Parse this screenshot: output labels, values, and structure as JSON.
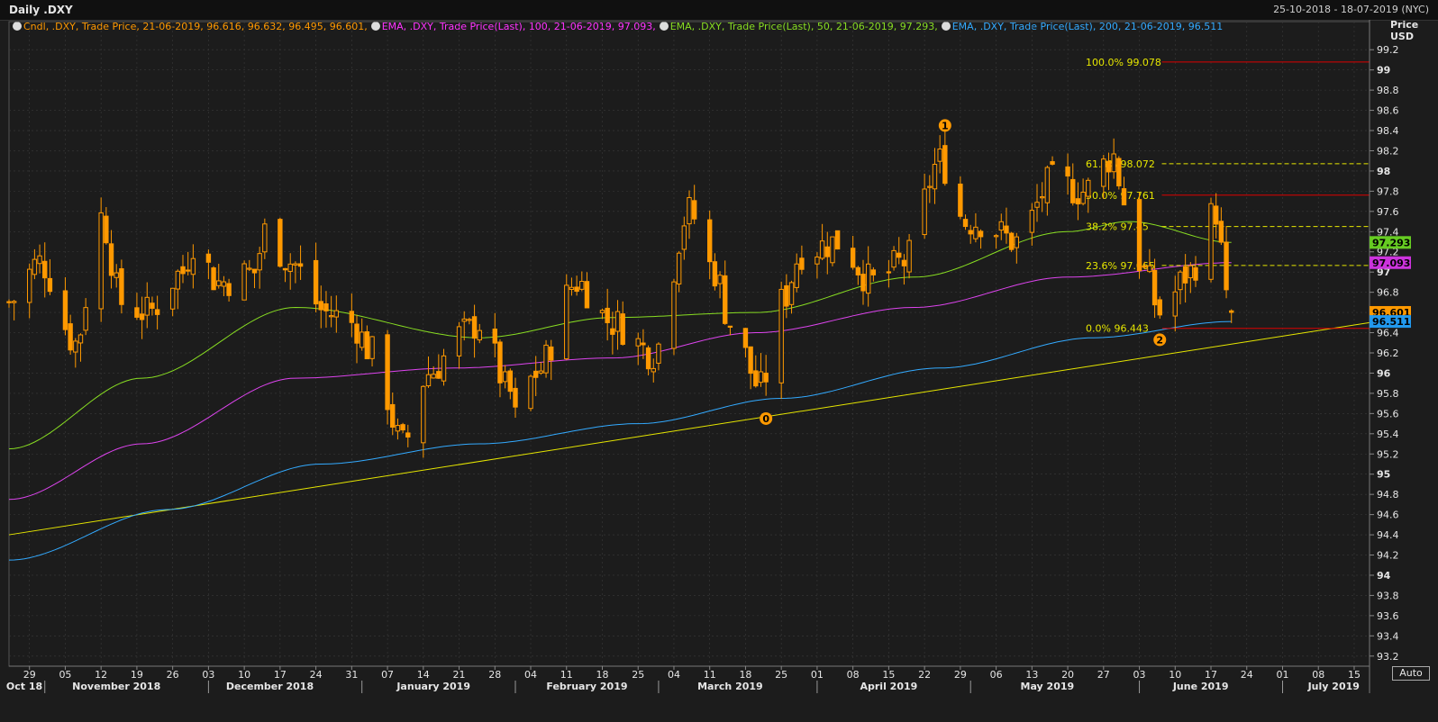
{
  "window": {
    "title": "Daily .DXY",
    "date_range": "25-10-2018 - 18-07-2019 (NYC)",
    "price_label": "Price",
    "currency_label": "USD",
    "auto_label": "Auto"
  },
  "legend": [
    {
      "text": "Cndl, .DXY, Trade Price, 21-06-2019, 96.616, 96.632, 96.495, 96.601,",
      "color": "#ff9900"
    },
    {
      "text": "EMA, .DXY, Trade Price(Last), 100, 21-06-2019, 97.093,",
      "color": "#ff33ff"
    },
    {
      "text": "EMA, .DXY, Trade Price(Last), 50, 21-06-2019, 97.293,",
      "color": "#88dd22"
    },
    {
      "text": "EMA, .DXY, Trade Price(Last), 200, 21-06-2019, 96.511",
      "color": "#33aaff"
    }
  ],
  "colors": {
    "background": "#1c1c1c",
    "grid": "#3a3a3a",
    "candle": "#ff9900",
    "ema50": "#88dd22",
    "ema100": "#dd44ee",
    "ema200": "#33aaff",
    "trendline": "#e6e600",
    "fib_solid": "#dd0000",
    "fib_dashed": "#e6e600",
    "axis_text": "#e6e6e6"
  },
  "chart_data": {
    "type": "candlestick",
    "x_range": [
      "2018-10-25",
      "2019-07-18"
    ],
    "ylim": [
      93.1,
      99.3
    ],
    "y_ticks": [
      93.2,
      93.4,
      93.6,
      93.8,
      94,
      94.2,
      94.4,
      94.6,
      94.8,
      95,
      95.2,
      95.4,
      95.6,
      95.8,
      96,
      96.2,
      96.4,
      96.6,
      96.8,
      97,
      97.2,
      97.4,
      97.6,
      97.8,
      98,
      98.2,
      98.4,
      98.6,
      98.8,
      99,
      99.2
    ],
    "y_tick_labels": [
      "93.2",
      "93.4",
      "93.6",
      "93.8",
      "94",
      "94.2",
      "94.4",
      "94.6",
      "94.8",
      "95",
      "95.2",
      "95.4",
      "95.6",
      "95.8",
      "96",
      "96.2",
      "96.4",
      "96.6",
      "96.8",
      "97",
      "97.2",
      "97.4",
      "97.6",
      "97.8",
      "98",
      "98.2",
      "98.4",
      "98.6",
      "98.8",
      "99",
      "99.2"
    ],
    "bold_ticks": [
      "94",
      "95",
      "96",
      "97",
      "98",
      "99"
    ],
    "day_ticks": [
      {
        "date": "2018-10-29",
        "label": "29"
      },
      {
        "date": "2018-11-05",
        "label": "05"
      },
      {
        "date": "2018-11-12",
        "label": "12"
      },
      {
        "date": "2018-11-19",
        "label": "19"
      },
      {
        "date": "2018-11-26",
        "label": "26"
      },
      {
        "date": "2018-12-03",
        "label": "03"
      },
      {
        "date": "2018-12-10",
        "label": "10"
      },
      {
        "date": "2018-12-17",
        "label": "17"
      },
      {
        "date": "2018-12-24",
        "label": "24"
      },
      {
        "date": "2018-12-31",
        "label": "31"
      },
      {
        "date": "2019-01-07",
        "label": "07"
      },
      {
        "date": "2019-01-14",
        "label": "14"
      },
      {
        "date": "2019-01-21",
        "label": "21"
      },
      {
        "date": "2019-01-28",
        "label": "28"
      },
      {
        "date": "2019-02-04",
        "label": "04"
      },
      {
        "date": "2019-02-11",
        "label": "11"
      },
      {
        "date": "2019-02-18",
        "label": "18"
      },
      {
        "date": "2019-02-25",
        "label": "25"
      },
      {
        "date": "2019-03-04",
        "label": "04"
      },
      {
        "date": "2019-03-11",
        "label": "11"
      },
      {
        "date": "2019-03-18",
        "label": "18"
      },
      {
        "date": "2019-03-25",
        "label": "25"
      },
      {
        "date": "2019-04-01",
        "label": "01"
      },
      {
        "date": "2019-04-08",
        "label": "08"
      },
      {
        "date": "2019-04-15",
        "label": "15"
      },
      {
        "date": "2019-04-22",
        "label": "22"
      },
      {
        "date": "2019-04-29",
        "label": "29"
      },
      {
        "date": "2019-05-06",
        "label": "06"
      },
      {
        "date": "2019-05-13",
        "label": "13"
      },
      {
        "date": "2019-05-20",
        "label": "20"
      },
      {
        "date": "2019-05-27",
        "label": "27"
      },
      {
        "date": "2019-06-03",
        "label": "03"
      },
      {
        "date": "2019-06-10",
        "label": "10"
      },
      {
        "date": "2019-06-17",
        "label": "17"
      },
      {
        "date": "2019-06-24",
        "label": "24"
      },
      {
        "date": "2019-07-01",
        "label": "01"
      },
      {
        "date": "2019-07-08",
        "label": "08"
      },
      {
        "date": "2019-07-15",
        "label": "15"
      }
    ],
    "month_labels": [
      {
        "date": "2018-10-28",
        "label": "Oct 18"
      },
      {
        "date": "2018-11-15",
        "label": "November 2018"
      },
      {
        "date": "2018-12-15",
        "label": "December 2018"
      },
      {
        "date": "2019-01-16",
        "label": "January 2019"
      },
      {
        "date": "2019-02-15",
        "label": "February 2019"
      },
      {
        "date": "2019-03-15",
        "label": "March 2019"
      },
      {
        "date": "2019-04-15",
        "label": "April 2019"
      },
      {
        "date": "2019-05-16",
        "label": "May 2019"
      },
      {
        "date": "2019-06-15",
        "label": "June 2019"
      },
      {
        "date": "2019-07-11",
        "label": "July 2019"
      }
    ],
    "month_separators": [
      "2018-11-01",
      "2018-12-03",
      "2019-01-02",
      "2019-02-01",
      "2019-03-01",
      "2019-04-01",
      "2019-05-01",
      "2019-06-03",
      "2019-07-01"
    ],
    "ohlc_anchors": [
      [
        "2018-10-25",
        96.7
      ],
      [
        "2018-10-31",
        97.1
      ],
      [
        "2018-11-07",
        96.3
      ],
      [
        "2018-11-12",
        97.55
      ],
      [
        "2018-11-16",
        96.7
      ],
      [
        "2018-11-21",
        96.6
      ],
      [
        "2018-11-28",
        97.0
      ],
      [
        "2018-11-30",
        97.3
      ],
      [
        "2018-12-05",
        96.9
      ],
      [
        "2018-12-12",
        97.0
      ],
      [
        "2018-12-14",
        97.4
      ],
      [
        "2018-12-19",
        97.1
      ],
      [
        "2018-12-26",
        96.6
      ],
      [
        "2018-12-31",
        96.5
      ],
      [
        "2019-01-04",
        96.2
      ],
      [
        "2019-01-10",
        95.3
      ],
      [
        "2019-01-15",
        96.0
      ],
      [
        "2019-01-22",
        96.4
      ],
      [
        "2019-01-25",
        96.5
      ],
      [
        "2019-01-31",
        95.8
      ],
      [
        "2019-02-01",
        95.55
      ],
      [
        "2019-02-05",
        96.0
      ],
      [
        "2019-02-13",
        96.9
      ],
      [
        "2019-02-20",
        96.5
      ],
      [
        "2019-02-28",
        96.2
      ],
      [
        "2019-03-07",
        97.6
      ],
      [
        "2019-03-12",
        97.0
      ],
      [
        "2019-03-15",
        96.5
      ],
      [
        "2019-03-21",
        95.85
      ],
      [
        "2019-03-25",
        96.7
      ],
      [
        "2019-03-29",
        97.2
      ],
      [
        "2019-04-05",
        97.3
      ],
      [
        "2019-04-12",
        96.9
      ],
      [
        "2019-04-18",
        97.1
      ],
      [
        "2019-04-25",
        98.1
      ],
      [
        "2019-04-30",
        97.5
      ],
      [
        "2019-05-03",
        97.5
      ],
      [
        "2019-05-10",
        97.3
      ],
      [
        "2019-05-17",
        97.9
      ],
      [
        "2019-05-23",
        97.8
      ],
      [
        "2019-05-29",
        98.15
      ],
      [
        "2019-05-31",
        97.7
      ],
      [
        "2019-06-04",
        97.0
      ],
      [
        "2019-06-07",
        96.6
      ],
      [
        "2019-06-13",
        97.0
      ],
      [
        "2019-06-17",
        97.55
      ],
      [
        "2019-06-18",
        97.6
      ],
      [
        "2019-06-19",
        97.2
      ],
      [
        "2019-06-20",
        96.7
      ],
      [
        "2019-06-21",
        96.601
      ]
    ],
    "last_candle": {
      "date": "2019-06-21",
      "open": 96.616,
      "high": 96.632,
      "low": 96.495,
      "close": 96.601
    },
    "series": [
      {
        "name": "EMA 50",
        "color": "#88dd22",
        "last": 97.293,
        "points": [
          [
            "2018-10-25",
            95.25
          ],
          [
            "2018-11-20",
            95.95
          ],
          [
            "2018-12-20",
            96.65
          ],
          [
            "2019-01-25",
            96.35
          ],
          [
            "2019-02-20",
            96.55
          ],
          [
            "2019-03-20",
            96.6
          ],
          [
            "2019-04-20",
            96.95
          ],
          [
            "2019-05-20",
            97.4
          ],
          [
            "2019-06-01",
            97.5
          ],
          [
            "2019-06-21",
            97.293
          ]
        ]
      },
      {
        "name": "EMA 100",
        "color": "#dd44ee",
        "last": 97.093,
        "points": [
          [
            "2018-10-25",
            94.75
          ],
          [
            "2018-11-20",
            95.3
          ],
          [
            "2018-12-20",
            95.95
          ],
          [
            "2019-01-20",
            96.05
          ],
          [
            "2019-02-20",
            96.15
          ],
          [
            "2019-03-20",
            96.4
          ],
          [
            "2019-04-20",
            96.65
          ],
          [
            "2019-05-20",
            96.95
          ],
          [
            "2019-06-21",
            97.093
          ]
        ]
      },
      {
        "name": "EMA 200",
        "color": "#33aaff",
        "last": 96.511,
        "points": [
          [
            "2018-10-25",
            94.15
          ],
          [
            "2018-11-25",
            94.65
          ],
          [
            "2018-12-25",
            95.1
          ],
          [
            "2019-01-25",
            95.3
          ],
          [
            "2019-02-25",
            95.5
          ],
          [
            "2019-03-25",
            95.75
          ],
          [
            "2019-04-25",
            96.05
          ],
          [
            "2019-05-25",
            96.35
          ],
          [
            "2019-06-21",
            96.511
          ]
        ]
      }
    ],
    "trendline": {
      "color": "#e6e600",
      "from": [
        "2018-10-25",
        94.4
      ],
      "to": [
        "2019-07-18",
        96.5
      ]
    },
    "fibonacci": [
      {
        "label": "100.0%",
        "value": 99.078,
        "text": "99.078",
        "style": "solid"
      },
      {
        "label": "61.8%",
        "value": 98.072,
        "text": "98.072",
        "style": "dashed"
      },
      {
        "label": "50.0%",
        "value": 97.761,
        "text": "97.761",
        "style": "solid"
      },
      {
        "label": "38.2%",
        "value": 97.45,
        "text": "97.45",
        "style": "dashed"
      },
      {
        "label": "23.6%",
        "value": 97.065,
        "text": "97.065",
        "style": "dashed"
      },
      {
        "label": "0.0%",
        "value": 96.443,
        "text": "96.443",
        "style": "solid"
      }
    ],
    "fib_start": "2019-05-31",
    "markers": [
      {
        "label": "0",
        "date": "2019-03-22",
        "value": 95.55
      },
      {
        "label": "1",
        "date": "2019-04-26",
        "value": 98.45
      },
      {
        "label": "2",
        "date": "2019-06-07",
        "value": 96.33
      }
    ],
    "price_tags": [
      {
        "text": "97.293",
        "value": 97.293,
        "bg": "#66cc22",
        "fg": "#000000"
      },
      {
        "text": "97.093",
        "value": 97.093,
        "bg": "#cc33dd",
        "fg": "#000000"
      },
      {
        "text": "96.601",
        "value": 96.601,
        "bg": "#ff9900",
        "fg": "#000000"
      },
      {
        "text": "96.511",
        "value": 96.511,
        "bg": "#2299ee",
        "fg": "#000000"
      }
    ]
  }
}
